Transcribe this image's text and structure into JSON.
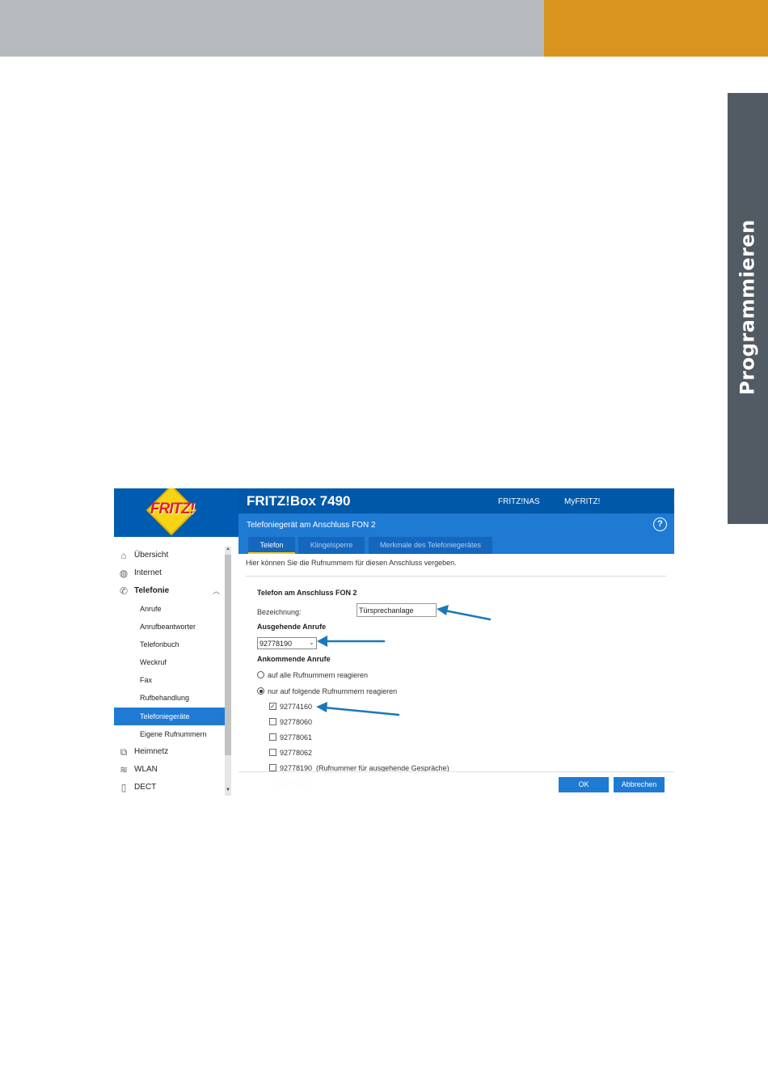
{
  "page": {
    "side_tab_label": "Programmieren",
    "colors": {
      "header_gray": "#b7babd",
      "header_orange": "#d8941e",
      "side_tab": "#525a63"
    }
  },
  "app": {
    "logo_text": "FRITZ!",
    "product_title": "FRITZ!Box 7490",
    "top_links": {
      "nas": "FRITZ!NAS",
      "myfritz": "MyFRITZ!"
    },
    "subtitle": "Telefoniegerät am Anschluss FON 2",
    "help_symbol": "?",
    "menu_icon": "more-vertical-icon",
    "colors": {
      "brand_blue": "#0058a8",
      "accent_blue": "#1f7ad3",
      "tab_underline": "#ffd200",
      "arrow": "#1a78b8"
    }
  },
  "tabs": [
    {
      "label": "Telefon",
      "active": true
    },
    {
      "label": "Klingelsperre",
      "active": false
    },
    {
      "label": "Merkmale des Telefoniegerätes",
      "active": false
    }
  ],
  "sidebar": {
    "items": [
      {
        "label": "Übersicht",
        "icon": "home-icon"
      },
      {
        "label": "Internet",
        "icon": "globe-icon"
      },
      {
        "label": "Telefonie",
        "icon": "phone-icon",
        "expanded": true
      },
      {
        "label": "Anrufe"
      },
      {
        "label": "Anrufbeantworter"
      },
      {
        "label": "Telefonbuch"
      },
      {
        "label": "Weckruf"
      },
      {
        "label": "Fax"
      },
      {
        "label": "Rufbehandlung"
      },
      {
        "label": "Telefoniegeräte",
        "selected": true
      },
      {
        "label": "Eigene Rufnummern"
      },
      {
        "label": "Heimnetz",
        "icon": "network-icon"
      },
      {
        "label": "WLAN",
        "icon": "wifi-icon"
      },
      {
        "label": "DECT",
        "icon": "dect-phone-icon"
      }
    ]
  },
  "content": {
    "intro": "Hier können Sie die Rufnummern für diesen Anschluss vergeben.",
    "phone_section_title": "Telefon am Anschluss FON 2",
    "bezeichnung_label": "Bezeichnung:",
    "bezeichnung_value": "Türsprechanlage",
    "outgoing_title": "Ausgehende Anrufe",
    "outgoing_selected": "92778190",
    "incoming_title": "Ankommende Anrufe",
    "incoming_options": [
      {
        "label": "auf alle Rufnummern reagieren",
        "checked": false
      },
      {
        "label": "nur auf folgende Rufnummern reagieren",
        "checked": true
      }
    ],
    "numbers": [
      {
        "label": "92774160",
        "checked": true
      },
      {
        "label": "92778060",
        "checked": false
      },
      {
        "label": "92778061",
        "checked": false
      },
      {
        "label": "92778062",
        "checked": false
      },
      {
        "label": "92778190  (Rufnummer für ausgehende Gespräche)",
        "checked": false
      },
      {
        "label": "92778191",
        "checked": false,
        "faded": true
      }
    ]
  },
  "buttons": {
    "ok": "OK",
    "cancel": "Abbrechen"
  }
}
